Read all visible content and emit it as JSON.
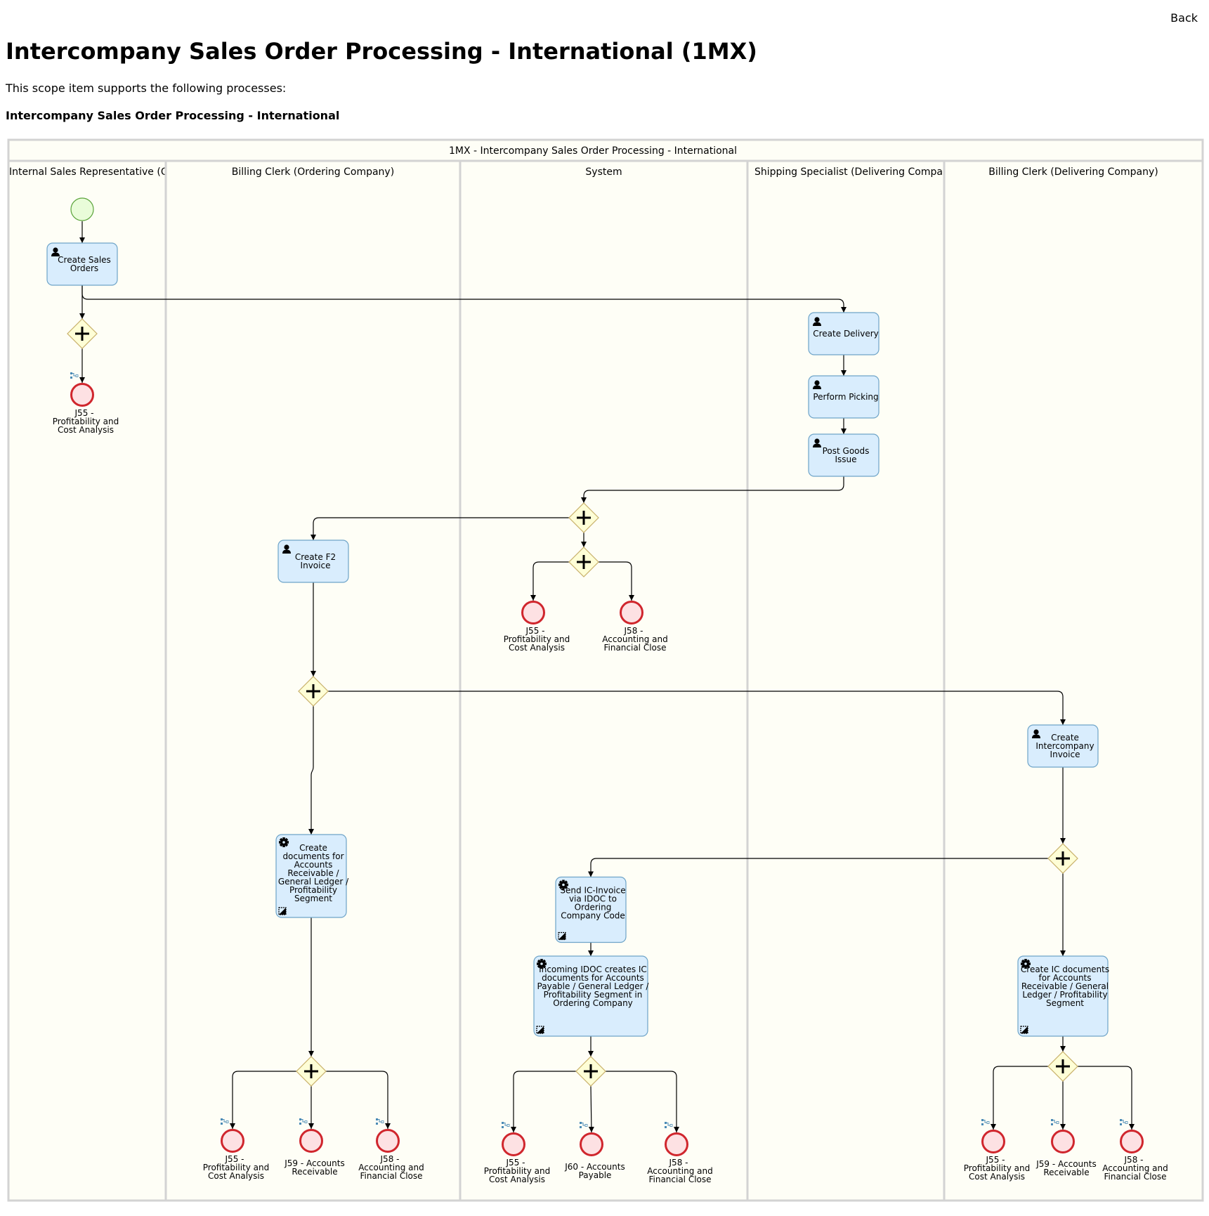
{
  "header": {
    "back_label": "Back",
    "title": "Intercompany Sales Order Processing - International (1MX)",
    "intro": "This scope item supports the following processes:",
    "process_heading": "Intercompany Sales Order Processing - International"
  },
  "colors": {
    "pool_bg": "#fefef6",
    "pool_border": "#d3d3d3",
    "task_fill": "#d9edfd",
    "task_stroke": "#6ea4c8",
    "gateway_fill": "#fefed6",
    "gateway_stroke": "#c8b06a",
    "start_fill": "#e9fcd9",
    "start_stroke": "#5aa33a",
    "end_fill": "#fde1e3",
    "end_stroke": "#d0262d",
    "link_icon": "#4a8ab5",
    "flow": "#000000"
  },
  "pool": {
    "title": "1MX - Intercompany Sales Order Processing - International",
    "lanes": [
      {
        "id": "isr",
        "label": "Internal Sales Representative (Ordering Company)",
        "visible_label": "Internal Sales Representative (C"
      },
      {
        "id": "bco",
        "label": "Billing Clerk (Ordering Company)",
        "visible_label": "Billing Clerk (Ordering Company)"
      },
      {
        "id": "sys",
        "label": "System",
        "visible_label": "System"
      },
      {
        "id": "ssd",
        "label": "Shipping Specialist (Delivering Company)",
        "visible_label": "Shipping Specialist (Delivering Compa"
      },
      {
        "id": "bcd",
        "label": "Billing Clerk (Delivering Company)",
        "visible_label": "Billing Clerk (Delivering Company)"
      }
    ]
  },
  "nodes": [
    {
      "id": "start",
      "type": "start",
      "lane": "isr"
    },
    {
      "id": "t_cso",
      "type": "user-task",
      "lane": "isr",
      "lines": [
        "Create Sales",
        "Orders"
      ]
    },
    {
      "id": "g1",
      "type": "parallel-gateway",
      "lane": "isr"
    },
    {
      "id": "e1",
      "type": "end",
      "lane": "isr",
      "link": true,
      "lines": [
        "J55 -",
        "Profitability and",
        "Cost Analysis"
      ]
    },
    {
      "id": "t_cd",
      "type": "user-task",
      "lane": "ssd",
      "lines": [
        "Create Delivery"
      ]
    },
    {
      "id": "t_pp",
      "type": "user-task",
      "lane": "ssd",
      "lines": [
        "Perform Picking"
      ]
    },
    {
      "id": "t_pgi",
      "type": "user-task",
      "lane": "ssd",
      "lines": [
        "Post Goods",
        "Issue"
      ]
    },
    {
      "id": "g2",
      "type": "parallel-gateway",
      "lane": "sys"
    },
    {
      "id": "g3",
      "type": "parallel-gateway",
      "lane": "sys"
    },
    {
      "id": "e2",
      "type": "end",
      "lane": "sys",
      "link": false,
      "lines": [
        "J55 -",
        "Profitability and",
        "Cost Analysis"
      ]
    },
    {
      "id": "e3",
      "type": "end",
      "lane": "sys",
      "link": false,
      "lines": [
        "J58 -",
        "Accounting and",
        "Financial Close"
      ]
    },
    {
      "id": "t_f2",
      "type": "user-task",
      "lane": "bco",
      "lines": [
        "Create F2",
        "Invoice"
      ]
    },
    {
      "id": "g4",
      "type": "parallel-gateway",
      "lane": "bco"
    },
    {
      "id": "t_ici",
      "type": "user-task",
      "lane": "bcd",
      "lines": [
        "Create",
        "Intercompany",
        "Invoice"
      ]
    },
    {
      "id": "t_cdar",
      "type": "service-task",
      "lane": "bco",
      "lines": [
        "Create",
        "documents for",
        "Accounts",
        "Receivable /",
        "General Ledger /",
        "Profitability",
        "Segment"
      ]
    },
    {
      "id": "g5",
      "type": "parallel-gateway",
      "lane": "bcd"
    },
    {
      "id": "t_send",
      "type": "service-task",
      "lane": "sys",
      "lines": [
        "Send IC-Invoice",
        "via IDOC to",
        "Ordering",
        "Company Code"
      ]
    },
    {
      "id": "t_inc",
      "type": "service-task",
      "lane": "sys",
      "lines": [
        "Incoming IDOC creates IC",
        "documents for Accounts",
        "Payable / General Ledger /",
        "Profitability Segment in",
        "Ordering Company"
      ]
    },
    {
      "id": "t_icdoc",
      "type": "service-task",
      "lane": "bcd",
      "lines": [
        "Create IC documents",
        "for Accounts",
        "Receivable / General",
        "Ledger / Profitability",
        "Segment"
      ]
    },
    {
      "id": "g6",
      "type": "parallel-gateway",
      "lane": "bco"
    },
    {
      "id": "g7",
      "type": "parallel-gateway",
      "lane": "sys"
    },
    {
      "id": "g8",
      "type": "parallel-gateway",
      "lane": "bcd"
    },
    {
      "id": "e4",
      "type": "end",
      "lane": "bco",
      "link": true,
      "lines": [
        "J55 -",
        "Profitability and",
        "Cost Analysis"
      ]
    },
    {
      "id": "e5",
      "type": "end",
      "lane": "bco",
      "link": true,
      "lines": [
        "J59 - Accounts",
        "Receivable"
      ]
    },
    {
      "id": "e6",
      "type": "end",
      "lane": "bco",
      "link": true,
      "lines": [
        "J58 -",
        "Accounting and",
        "Financial Close"
      ]
    },
    {
      "id": "e7",
      "type": "end",
      "lane": "sys",
      "link": true,
      "lines": [
        "J55 -",
        "Profitability and",
        "Cost Analysis"
      ]
    },
    {
      "id": "e8",
      "type": "end",
      "lane": "sys",
      "link": true,
      "lines": [
        "J60 - Accounts",
        "Payable"
      ]
    },
    {
      "id": "e9",
      "type": "end",
      "lane": "sys",
      "link": true,
      "lines": [
        "J58 -",
        "Accounting and",
        "Financial Close"
      ]
    },
    {
      "id": "e10",
      "type": "end",
      "lane": "bcd",
      "link": true,
      "lines": [
        "J55 -",
        "Profitability and",
        "Cost Analysis"
      ]
    },
    {
      "id": "e11",
      "type": "end",
      "lane": "bcd",
      "link": true,
      "lines": [
        "J59 - Accounts",
        "Receivable"
      ]
    },
    {
      "id": "e12",
      "type": "end",
      "lane": "bcd",
      "link": true,
      "lines": [
        "J58 -",
        "Accounting and",
        "Financial Close"
      ]
    }
  ],
  "flows": [
    [
      "start",
      "t_cso"
    ],
    [
      "t_cso",
      "g1"
    ],
    [
      "t_cso",
      "t_cd"
    ],
    [
      "g1",
      "e1"
    ],
    [
      "t_cd",
      "t_pp"
    ],
    [
      "t_pp",
      "t_pgi"
    ],
    [
      "t_pgi",
      "g2"
    ],
    [
      "g2",
      "t_f2"
    ],
    [
      "g2",
      "g3"
    ],
    [
      "g3",
      "e2"
    ],
    [
      "g3",
      "e3"
    ],
    [
      "t_f2",
      "g4"
    ],
    [
      "g4",
      "t_ici"
    ],
    [
      "g4",
      "t_cdar"
    ],
    [
      "t_ici",
      "g5"
    ],
    [
      "g5",
      "t_send"
    ],
    [
      "g5",
      "t_icdoc"
    ],
    [
      "t_send",
      "t_inc"
    ],
    [
      "t_cdar",
      "g6"
    ],
    [
      "t_inc",
      "g7"
    ],
    [
      "t_icdoc",
      "g8"
    ],
    [
      "g6",
      "e4"
    ],
    [
      "g6",
      "e5"
    ],
    [
      "g6",
      "e6"
    ],
    [
      "g7",
      "e7"
    ],
    [
      "g7",
      "e8"
    ],
    [
      "g7",
      "e9"
    ],
    [
      "g8",
      "e10"
    ],
    [
      "g8",
      "e11"
    ],
    [
      "g8",
      "e12"
    ]
  ]
}
